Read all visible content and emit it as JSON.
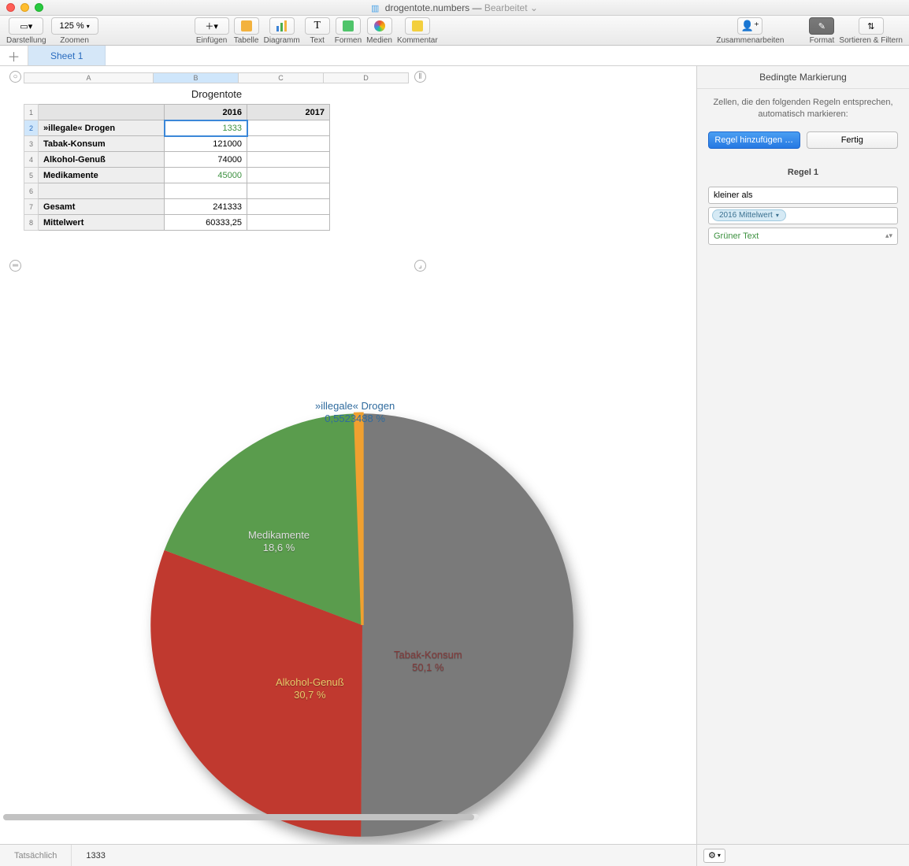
{
  "window": {
    "filename": "drogentote.numbers",
    "status": "Bearbeitet"
  },
  "toolbar": {
    "darstellung": "Darstellung",
    "zoom_value": "125 %",
    "zoom_label": "Zoomen",
    "einfuegen": "Einfügen",
    "tabelle": "Tabelle",
    "diagramm": "Diagramm",
    "text": "Text",
    "formen": "Formen",
    "medien": "Medien",
    "kommentar": "Kommentar",
    "zusammenarbeiten": "Zusammenarbeiten",
    "format": "Format",
    "sortieren": "Sortieren & Filtern"
  },
  "tabs": {
    "sheet1": "Sheet 1"
  },
  "columns": [
    "A",
    "B",
    "C",
    "D"
  ],
  "table_title": "Drogentote",
  "table": {
    "headers": {
      "col_b": "2016",
      "col_c": "2017"
    },
    "rows": [
      {
        "n": "1"
      },
      {
        "n": "2",
        "label": "»illegale« Drogen",
        "b": "1333",
        "b_green": true
      },
      {
        "n": "3",
        "label": "Tabak-Konsum",
        "b": "121000"
      },
      {
        "n": "4",
        "label": "Alkohol-Genuß",
        "b": "74000"
      },
      {
        "n": "5",
        "label": "Medikamente",
        "b": "45000",
        "b_green": true
      },
      {
        "n": "6"
      },
      {
        "n": "7",
        "label": "Gesamt",
        "b": "241333"
      },
      {
        "n": "8",
        "label": "Mittelwert",
        "b": "60333,25"
      }
    ]
  },
  "sidebar": {
    "title": "Bedingte Markierung",
    "description": "Zellen, die den folgenden Regeln entsprechen, automatisch markieren:",
    "add_rule": "Regel hinzufügen …",
    "done": "Fertig",
    "rule_title": "Regel 1",
    "condition": "kleiner als",
    "token": "2016 Mittelwert",
    "format": "Grüner Text"
  },
  "footer": {
    "tab": "Tatsächlich",
    "value": "1333"
  },
  "chart_data": {
    "type": "pie",
    "title": "Drogentote",
    "series": [
      {
        "name": "»illegale« Drogen",
        "value": 1333,
        "percent": 0.5523488,
        "percent_label": "0,5523488 %",
        "color": "#f0a030"
      },
      {
        "name": "Tabak-Konsum",
        "value": 121000,
        "percent": 50.1,
        "percent_label": "50,1 %",
        "color": "#7a7a7a"
      },
      {
        "name": "Alkohol-Genuß",
        "value": 74000,
        "percent": 30.7,
        "percent_label": "30,7 %",
        "color": "#c0392f"
      },
      {
        "name": "Medikamente",
        "value": 45000,
        "percent": 18.6,
        "percent_label": "18,6 %",
        "color": "#5a9c4d"
      }
    ]
  }
}
